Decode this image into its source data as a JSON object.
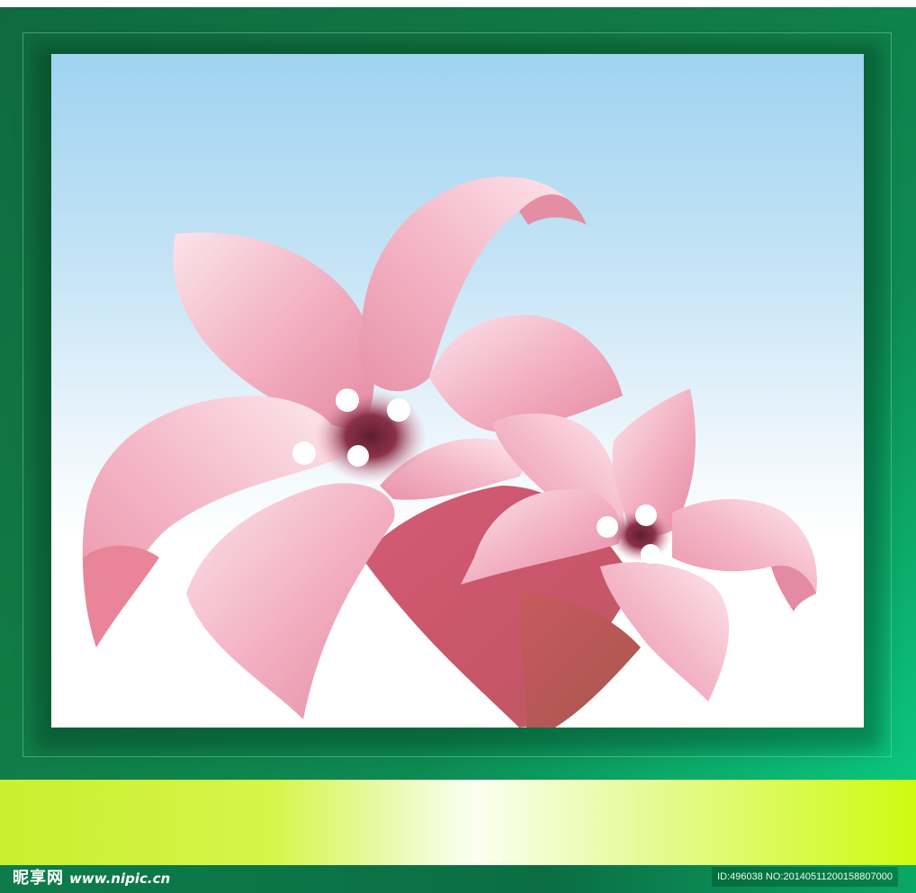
{
  "watermark": {
    "site_name": "昵享网",
    "url": "www.nipic.cn",
    "image_info": "ID:496038 NO:20140511200158807000"
  },
  "colors": {
    "frame": "#0f6b3f",
    "frame_highlight": "#0ac77e",
    "sky_top": "#9fd3f0",
    "petal_light": "#f7c9d6",
    "petal_mid": "#ec98b0",
    "petal_dark": "#c85a6e",
    "center": "#7a2a3c",
    "stamen": "#ffffff",
    "band_left": "#c9ef2f",
    "band_right": "#cdfb10"
  },
  "illustration": {
    "subject": "two pink lily flowers on a sky-blue gradient background inside a dark green frame",
    "icon": "lily-flower-icon"
  }
}
